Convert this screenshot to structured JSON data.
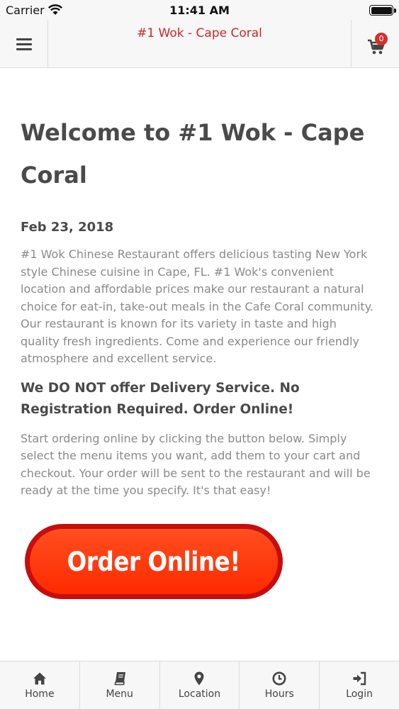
{
  "status_bar": {
    "carrier": "Carrier",
    "time": "11:41 AM"
  },
  "header": {
    "title": "#1 Wok - Cape Coral",
    "cart_count": "0",
    "title_color": "#c8282d"
  },
  "main": {
    "title": "Welcome to #1 Wok - Cape Coral",
    "date": "Feb 23, 2018",
    "intro": "#1 Wok Chinese Restaurant offers delicious tasting New York style Chinese cuisine in Cape, FL.  #1 Wok's convenient location and affordable prices make our restaurant a natural choice for eat-in, take-out meals in the Cafe Coral community. Our restaurant is known for its variety in taste and high quality fresh ingredients. Come and experience our friendly atmosphere and excellent service.",
    "subheading": "We DO NOT offer Delivery Service. No Registration Required. Order Online!",
    "instructions": "Start ordering online by clicking the button below. Simply select the menu items you want, add them to your cart and checkout. Your order will be sent to the restaurant and will be ready at the time you specify. It's that easy!",
    "order_button": "Order Online!"
  },
  "bottom_nav": {
    "items": [
      {
        "label": "Home",
        "icon": "home-icon"
      },
      {
        "label": "Menu",
        "icon": "book-icon"
      },
      {
        "label": "Location",
        "icon": "map-pin-icon"
      },
      {
        "label": "Hours",
        "icon": "clock-icon"
      },
      {
        "label": "Login",
        "icon": "login-icon"
      }
    ]
  }
}
